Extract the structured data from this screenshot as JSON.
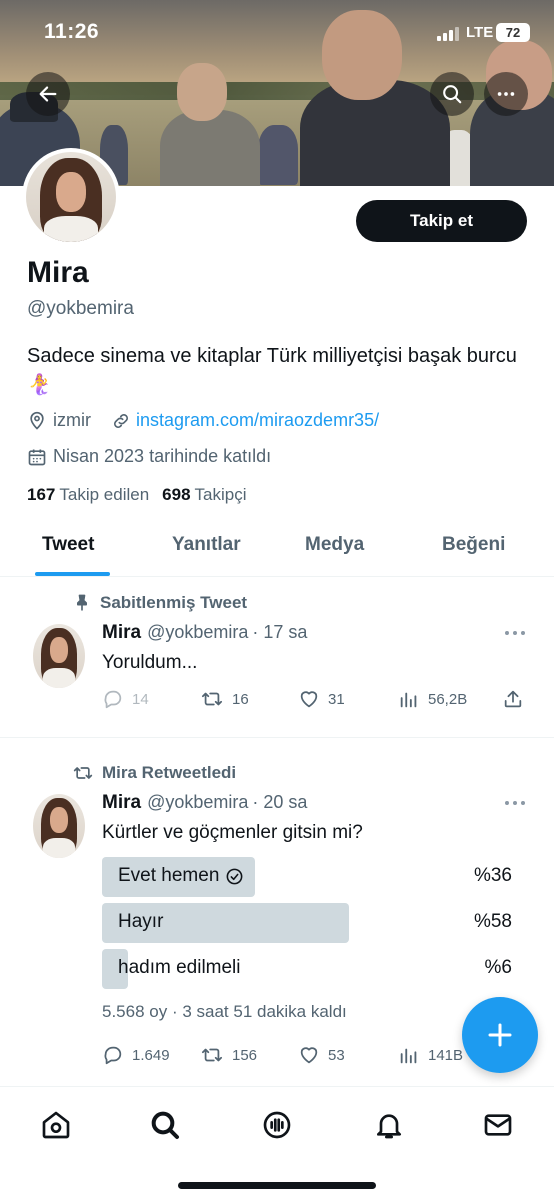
{
  "status_bar": {
    "time": "11:26",
    "network": "LTE",
    "battery": "72"
  },
  "header": {
    "back_icon": "arrow-left-icon",
    "search_icon": "search-icon",
    "more_icon": "more-horizontal-icon"
  },
  "profile": {
    "display_name": "Mira",
    "handle": "@yokbemira",
    "follow_label": "Takip et",
    "bio": "Sadece sinema ve kitaplar Türk milliyetçisi başak burcu 🧜‍♀️",
    "location": "izmir",
    "link": "instagram.com/miraozdemr35/",
    "joined": "Nisan 2023 tarihinde katıldı",
    "following_count": "167",
    "following_label": "Takip edilen",
    "followers_count": "698",
    "followers_label": "Takipçi"
  },
  "tabs": [
    {
      "label": "Tweet",
      "active": true
    },
    {
      "label": "Yanıtlar",
      "active": false
    },
    {
      "label": "Medya",
      "active": false
    },
    {
      "label": "Beğeni",
      "active": false
    }
  ],
  "tweets": [
    {
      "context": "Sabitlenmiş Tweet",
      "context_icon": "pin-icon",
      "name": "Mira",
      "handle": "@yokbemira",
      "time": "· 17 sa",
      "text": "Yoruldum...",
      "replies": "14",
      "retweets": "16",
      "likes": "31",
      "views": "56,2B"
    },
    {
      "context": "Mira Retweetledi",
      "context_icon": "retweet-icon",
      "name": "Mira",
      "handle": "@yokbemira",
      "time": "· 20 sa",
      "text": "Kürtler ve göçmenler gitsin mi?",
      "poll": {
        "options": [
          {
            "label": "Evet hemen",
            "percent_label": "%36",
            "fraction": 0.36,
            "voted": true
          },
          {
            "label": "Hayır",
            "percent_label": "%58",
            "fraction": 0.58,
            "voted": false
          },
          {
            "label": "hadım edilmeli",
            "percent_label": "%6",
            "fraction": 0.06,
            "voted": false
          }
        ],
        "meta": "5.568 oy · 3 saat 51 dakika kaldı"
      },
      "replies": "1.649",
      "retweets": "156",
      "likes": "53",
      "views": "141B"
    }
  ],
  "fab_icon": "plus-icon",
  "bottom_nav": [
    "home-icon",
    "search-icon",
    "spaces-icon",
    "notifications-icon",
    "messages-icon"
  ],
  "colors": {
    "accent": "#1d9bf0",
    "text": "#0f1419",
    "muted": "#536471",
    "poll_bar": "#cfd9de"
  }
}
